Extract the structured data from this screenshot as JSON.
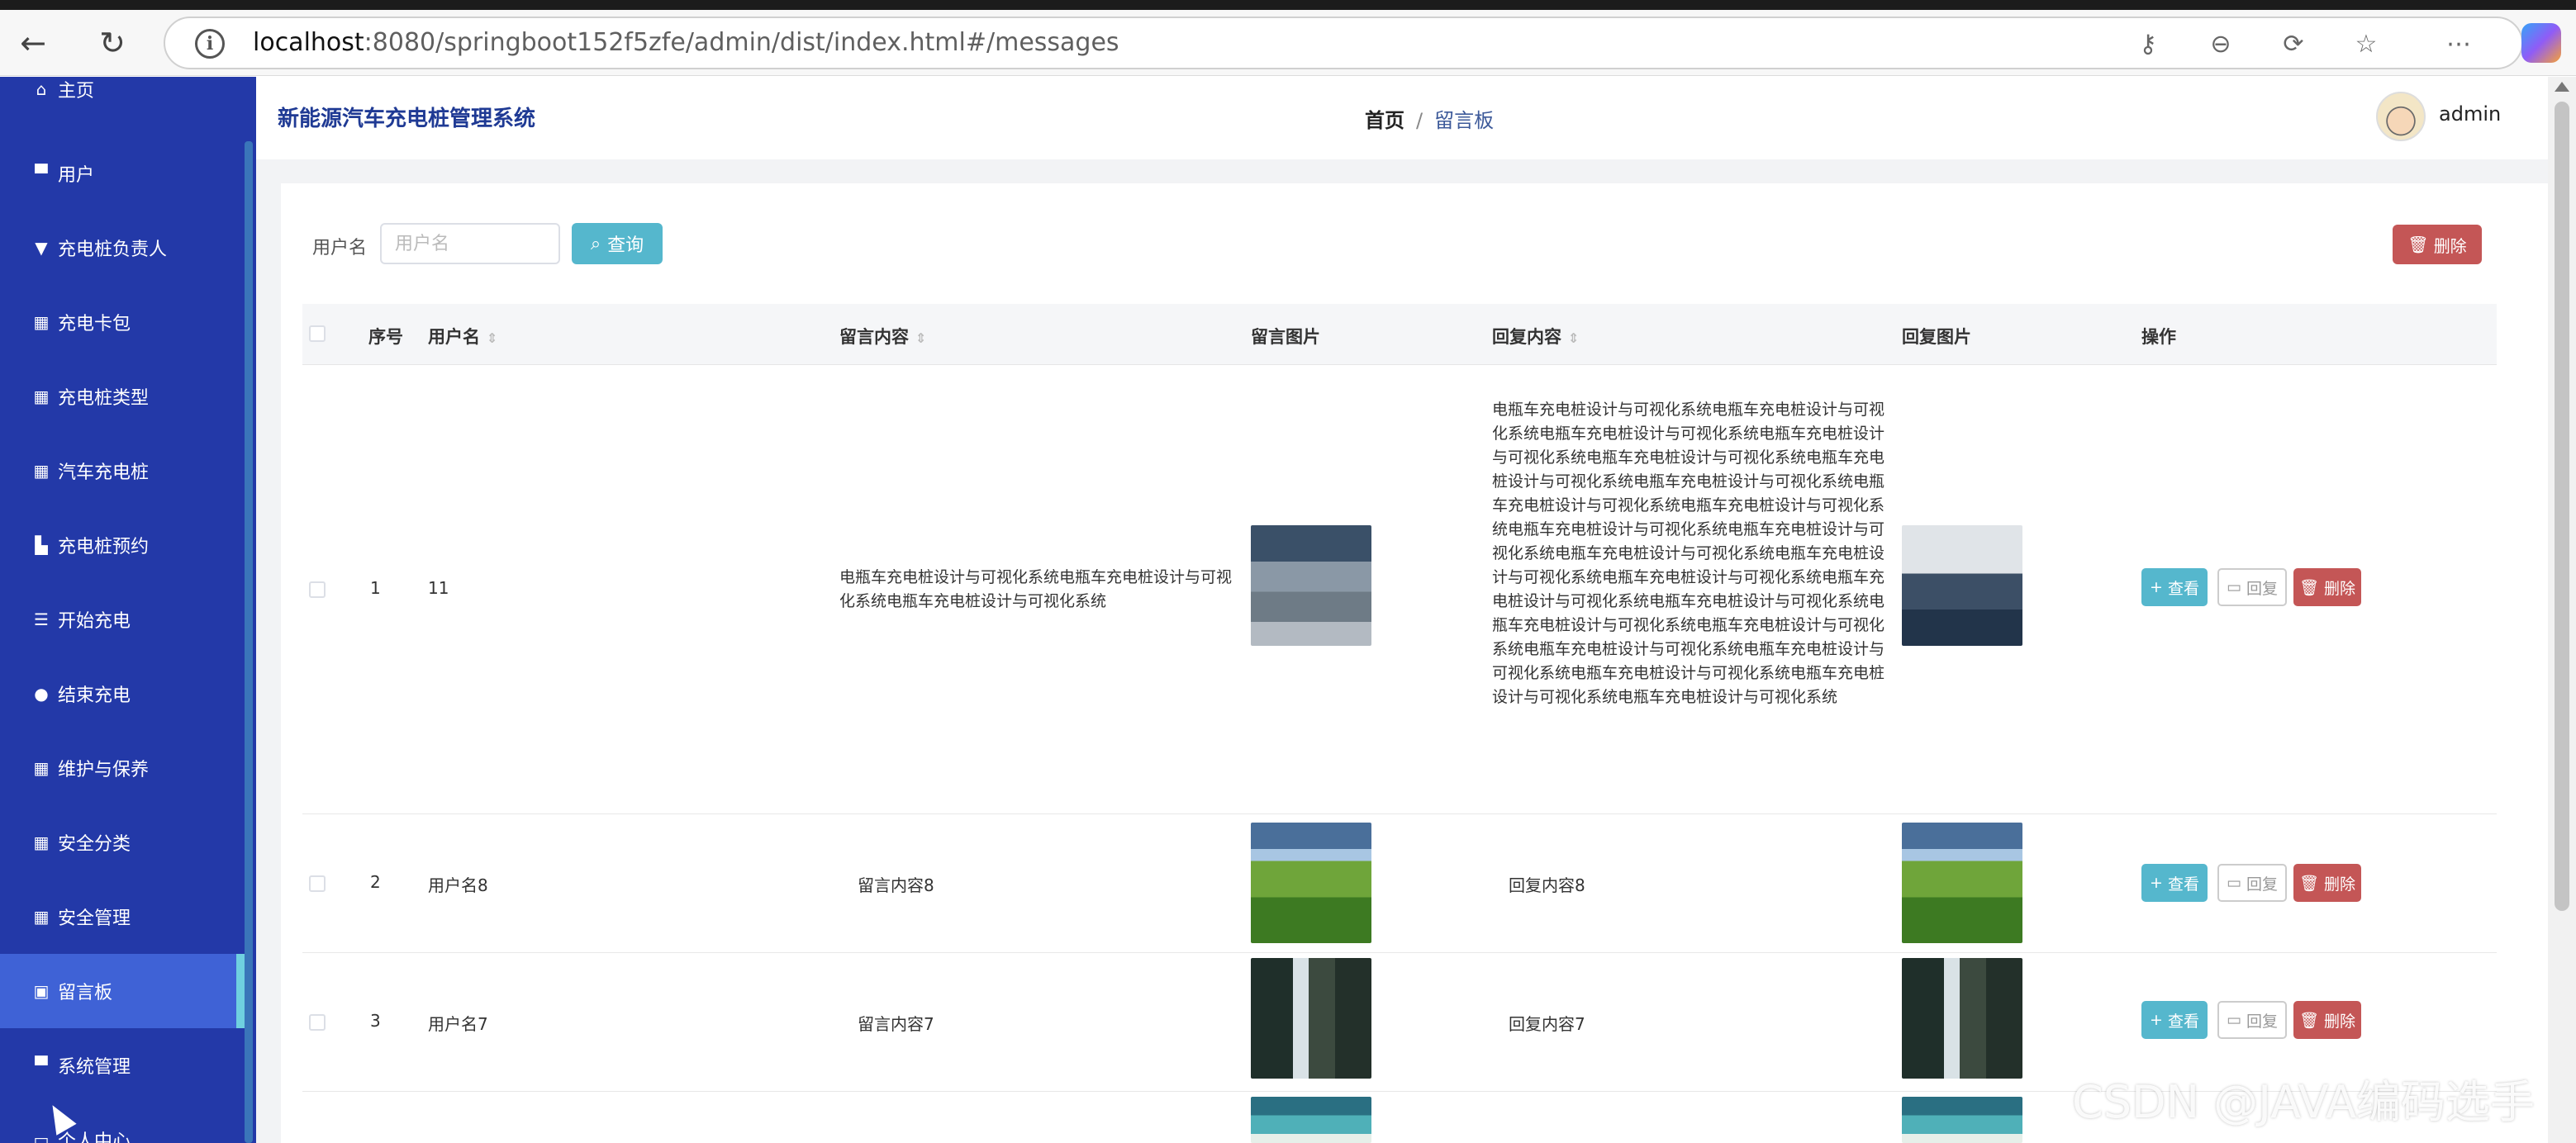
{
  "browser": {
    "url_host": "localhost",
    "url_rest": ":8080/springboot152f5zfe/admin/dist/index.html#/messages"
  },
  "sidebar": {
    "items": [
      {
        "label": "主页",
        "icon": "home-icon"
      },
      {
        "label": "用户",
        "icon": "user-icon"
      },
      {
        "label": "充电桩负责人",
        "icon": "manager-icon"
      },
      {
        "label": "充电卡包",
        "icon": "grid-icon"
      },
      {
        "label": "充电桩类型",
        "icon": "grid-icon"
      },
      {
        "label": "汽车充电桩",
        "icon": "grid-icon"
      },
      {
        "label": "充电桩预约",
        "icon": "chart-icon"
      },
      {
        "label": "开始充电",
        "icon": "list-icon"
      },
      {
        "label": "结束充电",
        "icon": "bulb-icon"
      },
      {
        "label": "维护与保养",
        "icon": "grid-icon"
      },
      {
        "label": "安全分类",
        "icon": "grid-icon"
      },
      {
        "label": "安全管理",
        "icon": "grid-icon"
      },
      {
        "label": "留言板",
        "icon": "board-icon",
        "active": true
      },
      {
        "label": "系统管理",
        "icon": "settings-icon"
      },
      {
        "label": "个人中心",
        "icon": "person-icon"
      }
    ]
  },
  "header": {
    "system_title": "新能源汽车充电桩管理系统",
    "breadcrumb_home": "首页",
    "breadcrumb_sep": "/",
    "breadcrumb_current": "留言板",
    "username": "admin"
  },
  "search": {
    "label": "用户名",
    "placeholder": "用户名",
    "query_button": "查询",
    "delete_button": "删除"
  },
  "table": {
    "headers": {
      "index": "序号",
      "username": "用户名",
      "message": "留言内容",
      "message_image": "留言图片",
      "reply": "回复内容",
      "reply_image": "回复图片",
      "actions": "操作"
    },
    "action_labels": {
      "view": "查看",
      "reply": "回复",
      "delete": "删除"
    },
    "rows": [
      {
        "index": "1",
        "username": "11",
        "message": "电瓶车充电桩设计与可视化系统电瓶车充电桩设计与可视化系统电瓶车充电桩设计与可视化系统",
        "reply": "电瓶车充电桩设计与可视化系统电瓶车充电桩设计与可视化系统电瓶车充电桩设计与可视化系统电瓶车充电桩设计与可视化系统电瓶车充电桩设计与可视化系统电瓶车充电桩设计与可视化系统电瓶车充电桩设计与可视化系统电瓶车充电桩设计与可视化系统电瓶车充电桩设计与可视化系统电瓶车充电桩设计与可视化系统电瓶车充电桩设计与可视化系统电瓶车充电桩设计与可视化系统电瓶车充电桩设计与可视化系统电瓶车充电桩设计与可视化系统电瓶车充电桩设计与可视化系统电瓶车充电桩设计与可视化系统电瓶车充电桩设计与可视化系统电瓶车充电桩设计与可视化系统电瓶车充电桩设计与可视化系统电瓶车充电桩设计与可视化系统电瓶车充电桩设计与可视化系统电瓶车充电桩设计与可视化系统电瓶车充电桩设计与可视化系统"
      },
      {
        "index": "2",
        "username": "用户名8",
        "message": "留言内容8",
        "reply": "回复内容8"
      },
      {
        "index": "3",
        "username": "用户名7",
        "message": "留言内容7",
        "reply": "回复内容7"
      }
    ]
  },
  "watermark": "CSDN @JAVA编码选手"
}
